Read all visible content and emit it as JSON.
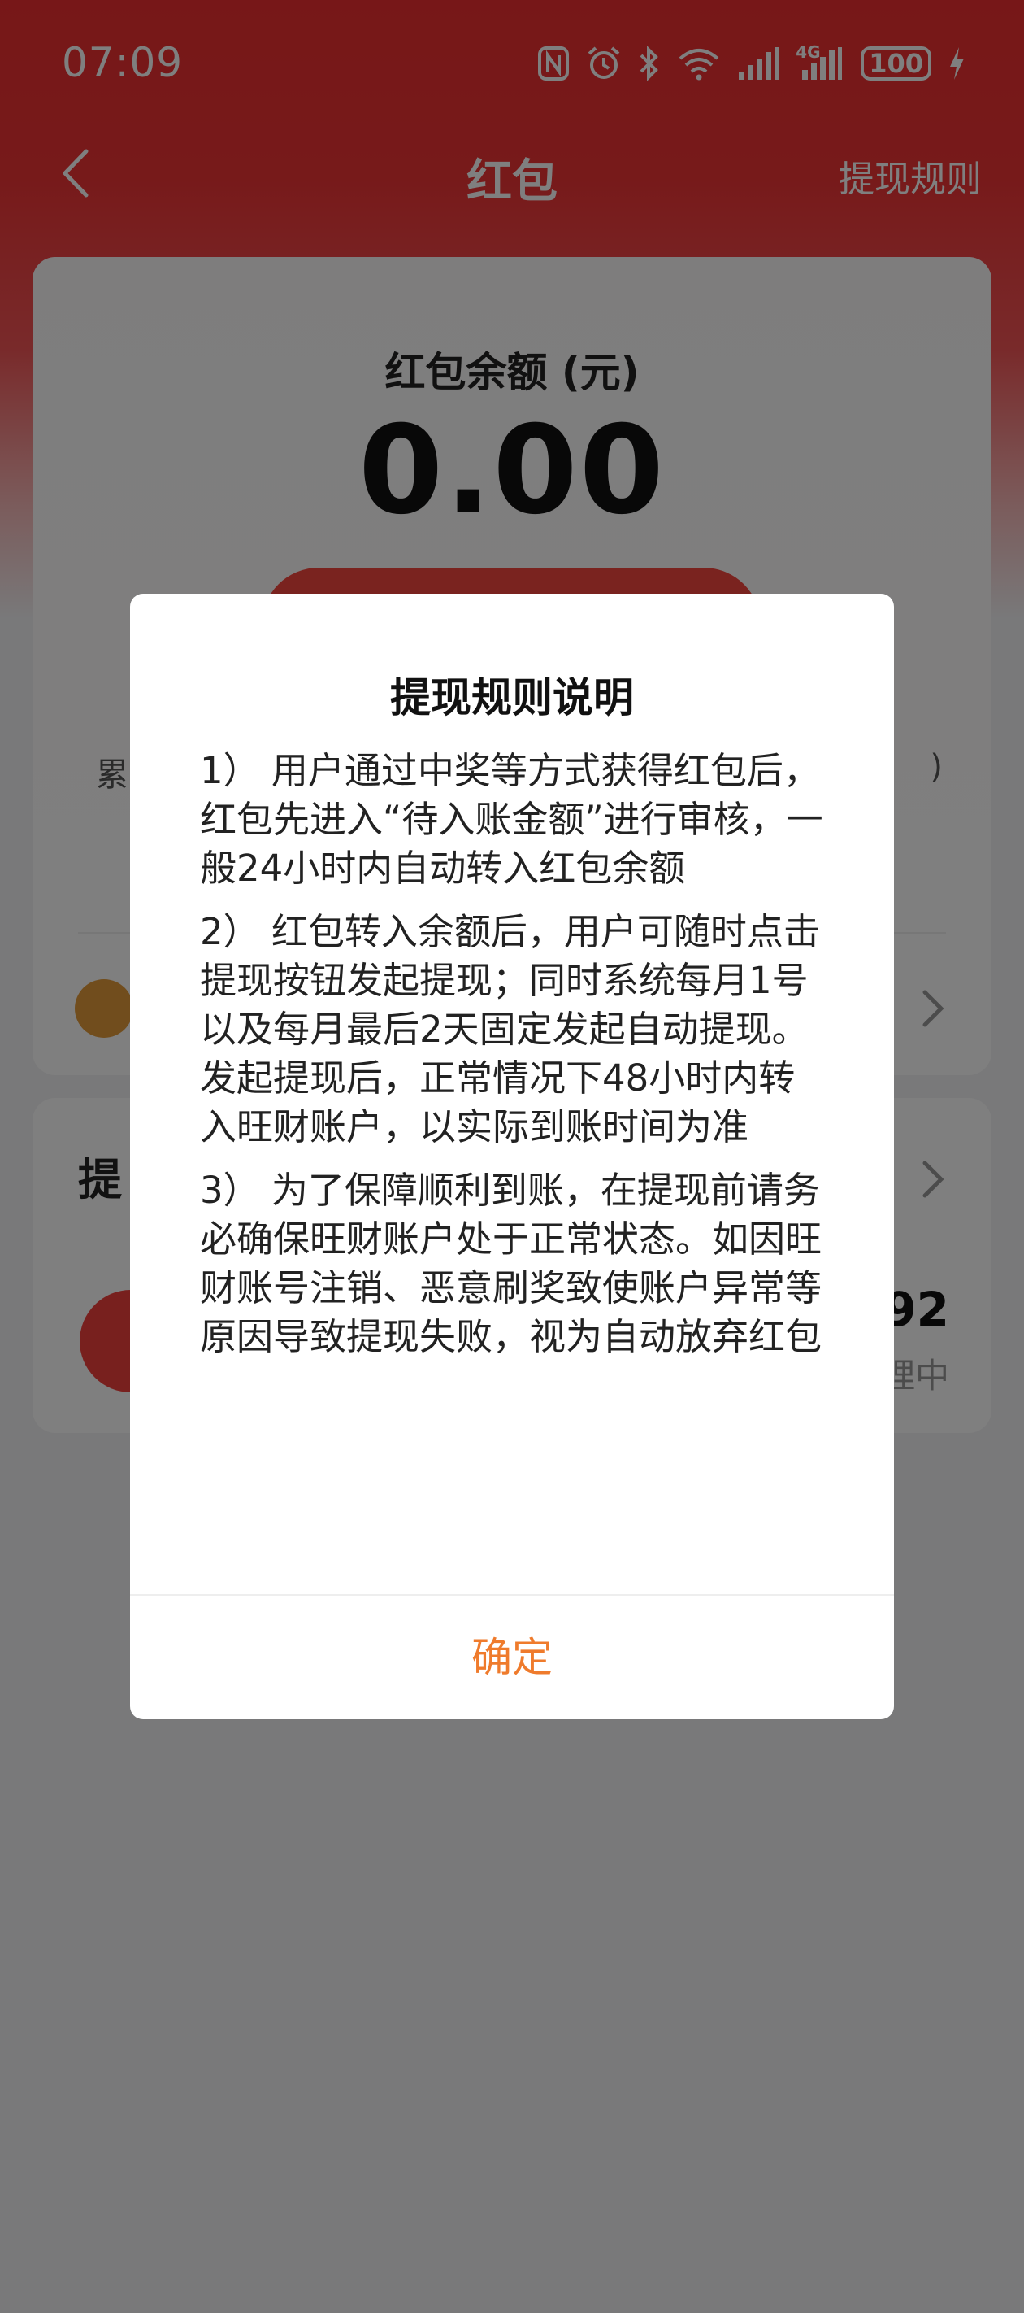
{
  "status_bar": {
    "time": "07:09",
    "network_label": "4G",
    "battery": "100",
    "icons": [
      "nfc-icon",
      "alarm-icon",
      "bluetooth-icon",
      "wifi-icon",
      "signal-icon",
      "signal-4g-icon",
      "battery-icon",
      "charging-icon"
    ]
  },
  "nav": {
    "title": "红包",
    "rules_link": "提现规则"
  },
  "balance_card": {
    "label": "红包余额 (元)",
    "value": "0.00",
    "stat_left_partial": "累",
    "stat_right_partial": ")"
  },
  "records_card": {
    "title_partial": "提",
    "amount_partial": "92",
    "status_partial": "理中"
  },
  "dialog": {
    "title": "提现规则说明",
    "rules": [
      "1） 用户通过中奖等方式获得红包后，红包先进入“待入账金额”进行审核，一般24小时内自动转入红包余额",
      "2） 红包转入余额后，用户可随时点击提现按钮发起提现；同时系统每月1号以及每月最后2天固定发起自动提现。发起提现后，正常情况下48小时内转入旺财账户，以实际到账时间为准",
      "3） 为了保障顺利到账，在提现前请务必确保旺财账户处于正常状态。如因旺财账号注销、恶意刷奖致使账户异常等原因导致提现失败，视为自动放弃红包"
    ],
    "confirm_label": "确定"
  },
  "colors": {
    "header_red": "#ef2f30",
    "confirm_orange": "#ef7b2c",
    "overlay": "rgba(0,0,0,0.5)"
  }
}
